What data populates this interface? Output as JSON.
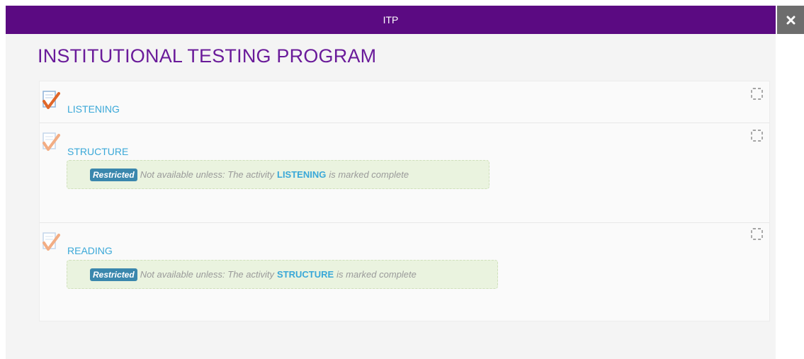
{
  "header": {
    "title": "ITP",
    "close_icon": "close-icon"
  },
  "page": {
    "title": "INSTITUTIONAL TESTING PROGRAM"
  },
  "activities": [
    {
      "name": "LISTENING",
      "icon": "quiz-check-icon",
      "completed_icon_state": "active",
      "restriction": null
    },
    {
      "name": "STRUCTURE",
      "icon": "quiz-check-icon",
      "completed_icon_state": "dimmed",
      "restriction": {
        "badge": "Restricted",
        "prefix": "Not available unless: The activity",
        "activity": "LISTENING",
        "suffix": "is marked complete"
      }
    },
    {
      "name": "READING",
      "icon": "quiz-check-icon",
      "completed_icon_state": "dimmed",
      "restriction": {
        "badge": "Restricted",
        "prefix": "Not available unless: The activity",
        "activity": "STRUCTURE",
        "suffix": "is marked complete"
      }
    }
  ],
  "colors": {
    "header_bg": "#5b0a82",
    "title": "#6a1b9a",
    "link": "#3aa8d8",
    "badge_bg": "#3a87ad",
    "restriction_bg": "#eaf3df",
    "check": "#e0672a"
  }
}
